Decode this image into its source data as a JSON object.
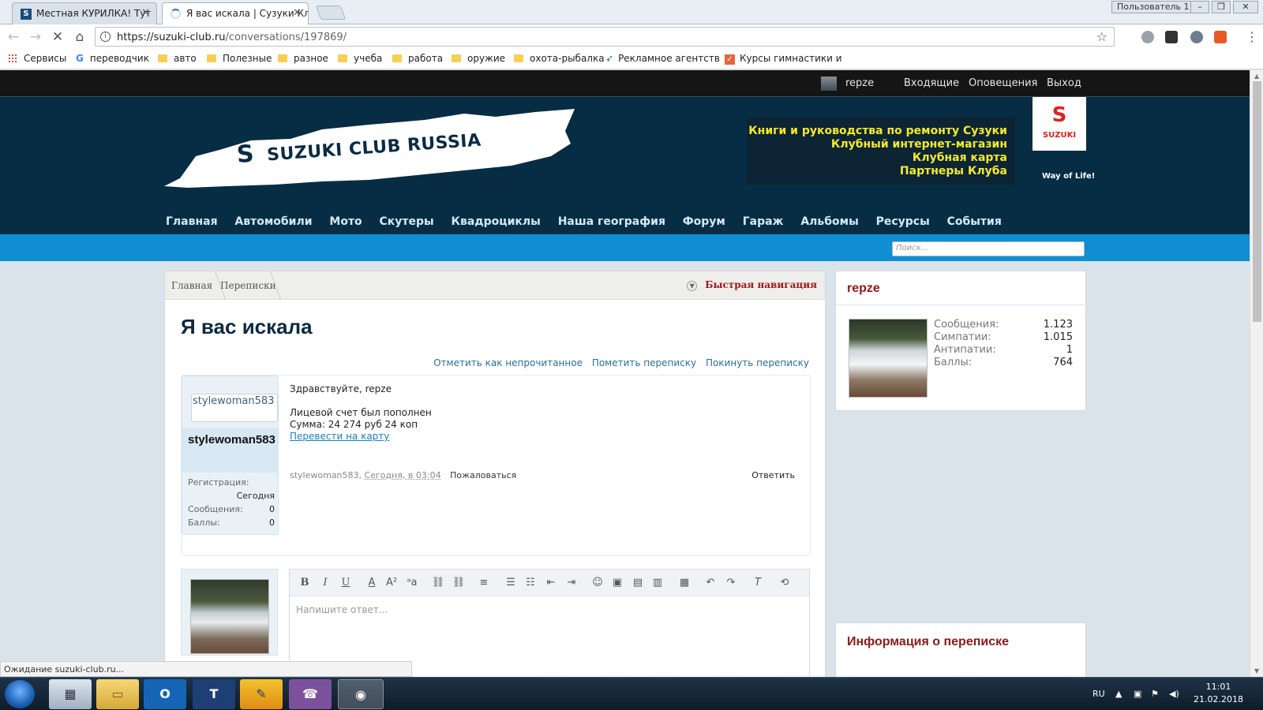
{
  "browser": {
    "tabs": [
      {
        "title": "Местная КУРИЛКА! Тут",
        "active": false
      },
      {
        "title": "Я вас искала | Сузуки Кл",
        "active": true
      }
    ],
    "profile_label": "Пользователь 1",
    "url_host": "https://suzuki-club.ru",
    "url_path": "/conversations/197869/",
    "bookmarks": [
      {
        "label": "Сервисы",
        "icon": "apps-icon"
      },
      {
        "label": "переводчик",
        "icon": "google-icon"
      },
      {
        "label": "авто",
        "icon": "folder-icon"
      },
      {
        "label": "Полезные",
        "icon": "folder-icon"
      },
      {
        "label": "разное",
        "icon": "folder-icon"
      },
      {
        "label": "учеба",
        "icon": "folder-icon"
      },
      {
        "label": "работа",
        "icon": "folder-icon"
      },
      {
        "label": "оружие",
        "icon": "folder-icon"
      },
      {
        "label": "охота-рыбалка",
        "icon": "folder-icon"
      },
      {
        "label": "Рекламное агентств",
        "icon": "bird-icon"
      },
      {
        "label": "Курсы гимнастики и",
        "icon": "check-icon"
      }
    ],
    "status_text": "Ожидание suzuki-club.ru..."
  },
  "userbar": {
    "username": "repze",
    "inbox": "Входящие",
    "alerts": "Оповещения",
    "logout": "Выход"
  },
  "header": {
    "logo_text": "SUZUKI CLUB RUSSIA",
    "logo_url": "www.suzuki-club.ru",
    "promo_links": [
      "Книги и руководства по ремонту Сузуки",
      "Клубный интернет-магазин",
      "Клубная карта",
      "Партнеры Клуба"
    ],
    "badge_brand": "SUZUKI",
    "slogan": "Way of Life!",
    "nav": [
      "Главная",
      "Автомобили",
      "Мото",
      "Скутеры",
      "Квадроциклы",
      "Наша география",
      "Форум",
      "Гараж",
      "Альбомы",
      "Ресурсы",
      "События"
    ],
    "search_placeholder": "Поиск..."
  },
  "breadcrumbs": {
    "items": [
      "Главная",
      "Переписки"
    ],
    "quick_nav": "Быстрая навигация"
  },
  "conversation": {
    "title": "Я вас искала",
    "actions": [
      "Отметить как непрочитанное",
      "Пометить переписку",
      "Покинуть переписку"
    ],
    "message": {
      "avatar_alt": "stylewoman583",
      "author": "stylewoman583",
      "stats": [
        {
          "label": "Регистрация:",
          "value": "Сегодня"
        },
        {
          "label": "Сообщения:",
          "value": "0"
        },
        {
          "label": "Баллы:",
          "value": "0"
        }
      ],
      "greeting": "Здравствуйте, repze",
      "line1": "Лицевой счет был пополнен",
      "line2": "Сумма: 24 274 руб 24 коп",
      "link": "Перевести на карту",
      "meta_author": "stylewoman583",
      "meta_date": "Сегодня, в 03:04",
      "report": "Пожаловаться",
      "reply": "Ответить"
    },
    "reply_placeholder": "Напишите ответ..."
  },
  "sidebar": {
    "user_title": "repze",
    "stats": [
      {
        "label": "Сообщения:",
        "value": "1.123"
      },
      {
        "label": "Симпатии:",
        "value": "1.015"
      },
      {
        "label": "Антипатии:",
        "value": "1"
      },
      {
        "label": "Баллы:",
        "value": "764"
      }
    ],
    "info_title": "Информация о переписке"
  },
  "taskbar": {
    "lang": "RU",
    "time": "11:01",
    "date": "21.02.2018"
  },
  "colors": {
    "header_bg": "#062d44",
    "bluebar": "#0f8ed4",
    "promo_text": "#f4ea2a",
    "sidebar_title": "#8b1a1a"
  }
}
